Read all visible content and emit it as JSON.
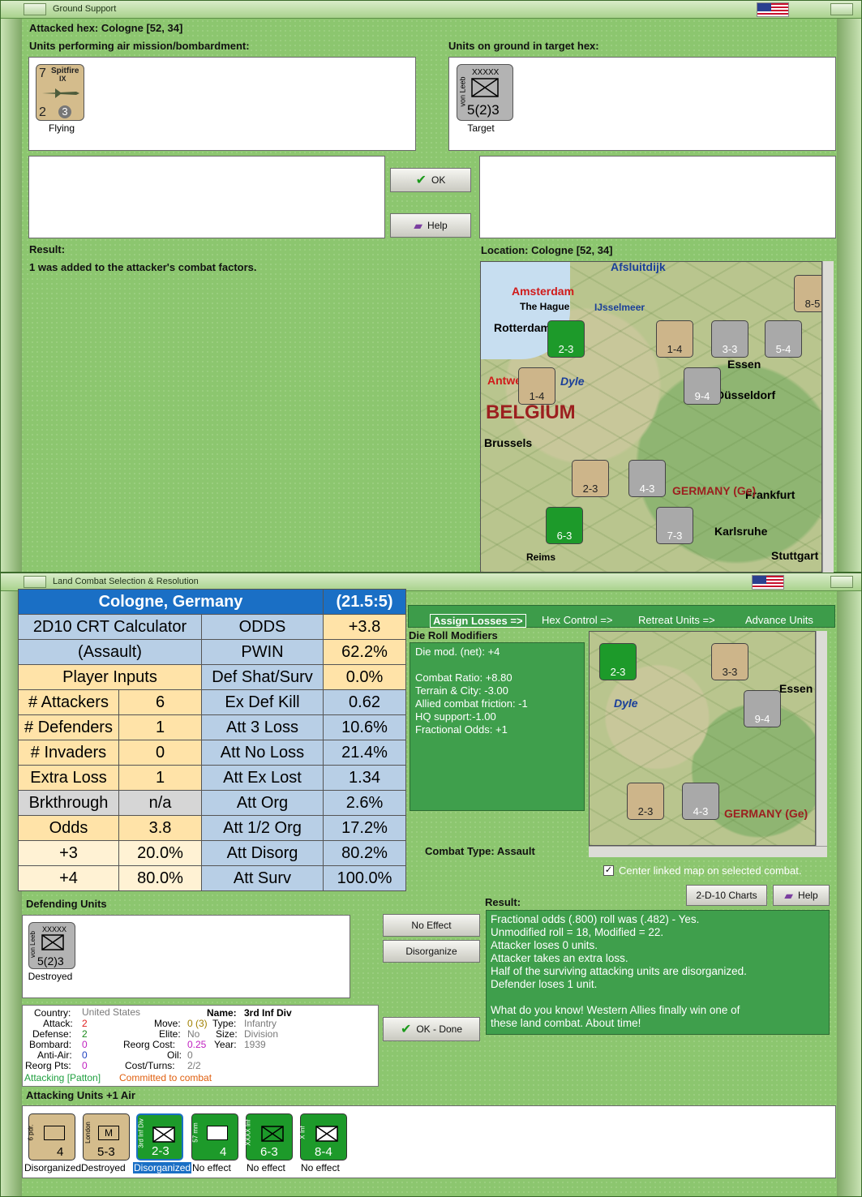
{
  "ground_support": {
    "window_title": "Ground Support",
    "attacked_hex": "Attacked hex: Cologne  [52, 34]",
    "air_units_label": "Units performing air mission/bombardment:",
    "ground_units_label": "Units on ground in target hex:",
    "air_unit": {
      "name": "Spitfire",
      "model": "IX",
      "attack": "7",
      "defense": "2",
      "range": "3",
      "status": "Flying"
    },
    "target_unit": {
      "size": "XXXXX",
      "commander": "von Leeb",
      "factors": "5(2)3",
      "status": "Target"
    },
    "ok_label": "OK",
    "help_label": "Help",
    "result_label": "Result:",
    "result_text": "1 was added to the attacker's combat factors.",
    "location_label": "Location:  Cologne  [52, 34]",
    "map": {
      "towns": [
        "Afsluitdijk",
        "Amsterdam",
        "The Hague",
        "IJsselmeer",
        "Rotterdam",
        "Antwerp",
        "Dyle",
        "BELGIUM",
        "Brussels",
        "Essen",
        "Düsseldorf",
        "Frankfurt",
        "GERMANY (Ge)",
        "Karlsruhe",
        "Stuttgart",
        "Reims"
      ],
      "counters": [
        {
          "label": "2-3",
          "color": "green"
        },
        {
          "label": "1-4",
          "color": "tan"
        },
        {
          "label": "3-3",
          "color": "gray"
        },
        {
          "label": "5-4",
          "color": "gray"
        },
        {
          "label": "1-4",
          "color": "tan"
        },
        {
          "label": "9-4",
          "color": "gray"
        },
        {
          "label": "2-3",
          "color": "tan"
        },
        {
          "label": "4-3",
          "color": "gray"
        },
        {
          "label": "6-3",
          "color": "green"
        },
        {
          "label": "7-3",
          "color": "gray"
        },
        {
          "label": "8-5",
          "color": "tan"
        }
      ]
    }
  },
  "land_combat": {
    "window_title": "Land Combat Selection & Resolution",
    "crt": {
      "header_left": "Cologne, Germany",
      "header_right": "(21.5:5)",
      "calc_title_1": "2D10 CRT Calculator",
      "calc_title_2": "(Assault)",
      "player_inputs": "Player Inputs",
      "left_rows": [
        {
          "label": "# Attackers",
          "value": "6"
        },
        {
          "label": "# Defenders",
          "value": "1"
        },
        {
          "label": "# Invaders",
          "value": "0"
        },
        {
          "label": "Extra Loss",
          "value": "1"
        },
        {
          "label": "Brkthrough",
          "value": "n/a"
        },
        {
          "label": "Odds",
          "value": "3.8"
        },
        {
          "label": "+3",
          "value": "20.0%"
        },
        {
          "label": "+4",
          "value": "80.0%"
        }
      ],
      "right_rows": [
        {
          "label": "ODDS",
          "value": "+3.8"
        },
        {
          "label": "PWIN",
          "value": "62.2%"
        },
        {
          "label": "Def Shat/Surv",
          "value": "0.0%"
        },
        {
          "label": "Ex Def Kill",
          "value": "0.62"
        },
        {
          "label": "Att 3 Loss",
          "value": "10.6%"
        },
        {
          "label": "Att No Loss",
          "value": "21.4%"
        },
        {
          "label": "Att Ex Lost",
          "value": "1.34"
        },
        {
          "label": "Att Org",
          "value": "2.6%"
        },
        {
          "label": "Att 1/2 Org",
          "value": "17.2%"
        },
        {
          "label": "Att Disorg",
          "value": "80.2%"
        },
        {
          "label": "Att Surv",
          "value": "100.0%"
        }
      ]
    },
    "tabs": [
      "Assign Losses =>",
      "Hex Control =>",
      "Retreat Units =>",
      "Advance Units"
    ],
    "die_roll_label": "Die Roll Modifiers",
    "die_roll_lines": [
      "Die mod. (net): +4",
      "",
      "Combat Ratio: +8.80",
      "Terrain & City: -3.00",
      "Allied combat friction: -1",
      "HQ support:-1.00",
      "Fractional Odds: +1"
    ],
    "combat_type": "Combat Type:  Assault",
    "center_map": "Center linked map on selected combat.",
    "charts_label": "2-D-10 Charts",
    "help_label": "Help",
    "defending_label": "Defending Units",
    "defender": {
      "size": "XXXXX",
      "commander": "von Leeb",
      "factors": "5(2)3",
      "status": "Destroyed"
    },
    "no_effect_label": "No Effect",
    "disorganize_label": "Disorganize",
    "ok_done_label": "OK - Done",
    "result_label": "Result:",
    "result_lines": [
      "Fractional odds (.800) roll was (.482)  - Yes.",
      "Unmodified roll = 18, Modified = 22.",
      "Attacker loses 0 units.",
      "Attacker takes an extra loss.",
      "Half of the surviving attacking units are disorganized.",
      "Defender loses 1 unit.",
      "",
      "What do you know!  Western Allies finally win one of",
      "these land combat.  About time!"
    ],
    "unit_info": {
      "country_label": "Country:",
      "country": "United States",
      "attack_label": "Attack:",
      "attack": "2",
      "defense_label": "Defense:",
      "defense": "2",
      "bombard_label": "Bombard:",
      "bombard": "0",
      "antiair_label": "Anti-Air:",
      "antiair": "0",
      "reorg_label": "Reorg Pts:",
      "reorg": "0",
      "move_label": "Move:",
      "move": "0 (3)",
      "elite_label": "Elite:",
      "elite": "No",
      "reorg_cost_label": "Reorg Cost:",
      "reorg_cost": "0.25",
      "oil_label": "Oil:",
      "oil": "0",
      "cost_label": "Cost/Turns:",
      "cost": "2/2",
      "name_label": "Name:",
      "name": "3rd Inf Div",
      "type_label": "Type:",
      "type": "Infantry",
      "size_label": "Size:",
      "size": "Division",
      "year_label": "Year:",
      "year": "1939",
      "attacking": "Attacking [Patton]",
      "committed": "Committed to combat"
    },
    "attacking_label": "Attacking Units +1 Air",
    "attackers": [
      {
        "name": "6 pdr.",
        "factors": "4",
        "status": "Disorganized",
        "color": "tan"
      },
      {
        "name": "London",
        "factors": "5-3",
        "status": "Destroyed",
        "color": "tan"
      },
      {
        "name": "3rd Inf Div",
        "factors": "2-3",
        "status": "Disorganized",
        "color": "green"
      },
      {
        "name": "57 mm",
        "factors": "4",
        "status": "No effect",
        "color": "green"
      },
      {
        "name": "XXXX Inf",
        "factors": "6-3",
        "status": "No effect",
        "color": "green"
      },
      {
        "name": "X Inf",
        "factors": "8-4",
        "status": "No effect",
        "color": "green"
      }
    ]
  }
}
